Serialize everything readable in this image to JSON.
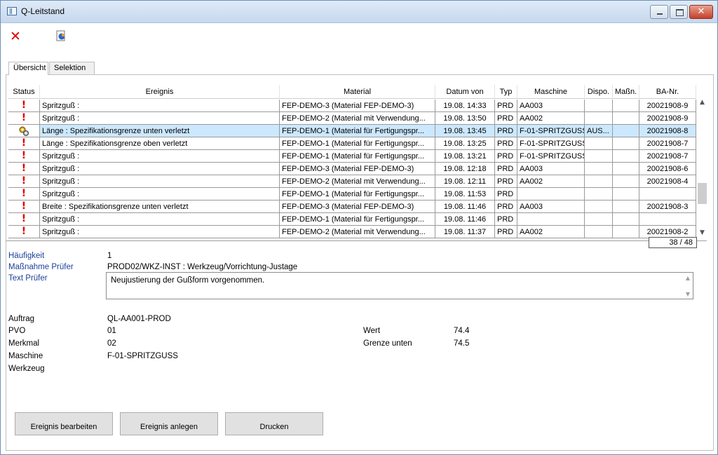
{
  "window": {
    "title": "Q-Leitstand"
  },
  "toolbar": {
    "close_icon": "red-x-icon",
    "report_icon": "pie-chart-report-icon"
  },
  "tabs": [
    {
      "label": "Übersicht",
      "active": true
    },
    {
      "label": "Selektion",
      "active": false
    }
  ],
  "table": {
    "headers": {
      "status": "Status",
      "ereignis": "Ereignis",
      "material": "Material",
      "datum": "Datum von",
      "typ": "Typ",
      "maschine": "Maschine",
      "dispo": "Dispo.",
      "massn": "Maßn.",
      "ba": "BA-Nr."
    },
    "rows": [
      {
        "status": "!",
        "ereignis": "Spritzguß :",
        "material": "FEP-DEMO-3 (Material FEP-DEMO-3)",
        "datum": "19.08. 14:33",
        "typ": "PRD",
        "maschine": "AA003",
        "dispo": "",
        "massn": "",
        "ba": "20021908-9"
      },
      {
        "status": "!",
        "ereignis": "Spritzguß :",
        "material": "FEP-DEMO-2 (Material mit Verwendung...",
        "datum": "19.08. 13:50",
        "typ": "PRD",
        "maschine": "AA002",
        "dispo": "",
        "massn": "",
        "ba": "20021908-9"
      },
      {
        "status": "gear",
        "ereignis": "Länge : Spezifikationsgrenze unten verletzt",
        "material": "FEP-DEMO-1 (Material für Fertigungspr...",
        "datum": "19.08. 13:45",
        "typ": "PRD",
        "maschine": "F-01-SPRITZGUSS",
        "dispo": "AUS...",
        "massn": "",
        "ba": "20021908-8"
      },
      {
        "status": "!",
        "ereignis": "Länge : Spezifikationsgrenze oben verletzt",
        "material": "FEP-DEMO-1 (Material für Fertigungspr...",
        "datum": "19.08. 13:25",
        "typ": "PRD",
        "maschine": "F-01-SPRITZGUSS",
        "dispo": "",
        "massn": "",
        "ba": "20021908-7"
      },
      {
        "status": "!",
        "ereignis": "Spritzguß :",
        "material": "FEP-DEMO-1 (Material für Fertigungspr...",
        "datum": "19.08. 13:21",
        "typ": "PRD",
        "maschine": "F-01-SPRITZGUSS",
        "dispo": "",
        "massn": "",
        "ba": "20021908-7"
      },
      {
        "status": "!",
        "ereignis": "Spritzguß :",
        "material": "FEP-DEMO-3 (Material FEP-DEMO-3)",
        "datum": "19.08. 12:18",
        "typ": "PRD",
        "maschine": "AA003",
        "dispo": "",
        "massn": "",
        "ba": "20021908-6"
      },
      {
        "status": "!",
        "ereignis": "Spritzguß :",
        "material": "FEP-DEMO-2 (Material mit Verwendung...",
        "datum": "19.08. 12:11",
        "typ": "PRD",
        "maschine": "AA002",
        "dispo": "",
        "massn": "",
        "ba": "20021908-4"
      },
      {
        "status": "!",
        "ereignis": "Spritzguß :",
        "material": "FEP-DEMO-1 (Material für Fertigungspr...",
        "datum": "19.08. 11:53",
        "typ": "PRD",
        "maschine": "",
        "dispo": "",
        "massn": "",
        "ba": ""
      },
      {
        "status": "!",
        "ereignis": "Breite : Spezifikationsgrenze unten verletzt",
        "material": "FEP-DEMO-3 (Material FEP-DEMO-3)",
        "datum": "19.08. 11:46",
        "typ": "PRD",
        "maschine": "AA003",
        "dispo": "",
        "massn": "",
        "ba": "20021908-3"
      },
      {
        "status": "!",
        "ereignis": "Spritzguß :",
        "material": "FEP-DEMO-1 (Material für Fertigungspr...",
        "datum": "19.08. 11:46",
        "typ": "PRD",
        "maschine": "",
        "dispo": "",
        "massn": "",
        "ba": ""
      },
      {
        "status": "!",
        "ereignis": "Spritzguß :",
        "material": "FEP-DEMO-2 (Material mit Verwendung...",
        "datum": "19.08. 11:37",
        "typ": "PRD",
        "maschine": "AA002",
        "dispo": "",
        "massn": "",
        "ba": "20021908-2"
      }
    ],
    "selected_row": 2,
    "record_counter": "38 / 48"
  },
  "details": {
    "haeufigkeit_label": "Häufigkeit",
    "haeufigkeit_value": "1",
    "massnahme_label": "Maßnahme Prüfer",
    "massnahme_value": "PROD02/WKZ-INST : Werkzeug/Vorrichtung-Justage",
    "text_label": "Text Prüfer",
    "text_value": "Neujustierung der Gußform vorgenommen.",
    "auftrag_label": "Auftrag",
    "auftrag_value": "QL-AA001-PROD",
    "pvo_label": "PVO",
    "pvo_value": "01",
    "merkmal_label": "Merkmal",
    "merkmal_value": "02",
    "maschine_label": "Maschine",
    "maschine_value": "F-01-SPRITZGUSS",
    "werkzeug_label": "Werkzeug",
    "wert_label": "Wert",
    "wert_value": "74.4",
    "grenze_label": "Grenze unten",
    "grenze_value": "74.5"
  },
  "buttons": {
    "bearbeiten": "Ereignis bearbeiten",
    "anlegen": "Ereignis anlegen",
    "drucken": "Drucken"
  },
  "colors": {
    "status_exclamation": "#e30000",
    "selection": "#cce8ff",
    "label_blue": "#1f3f99"
  }
}
